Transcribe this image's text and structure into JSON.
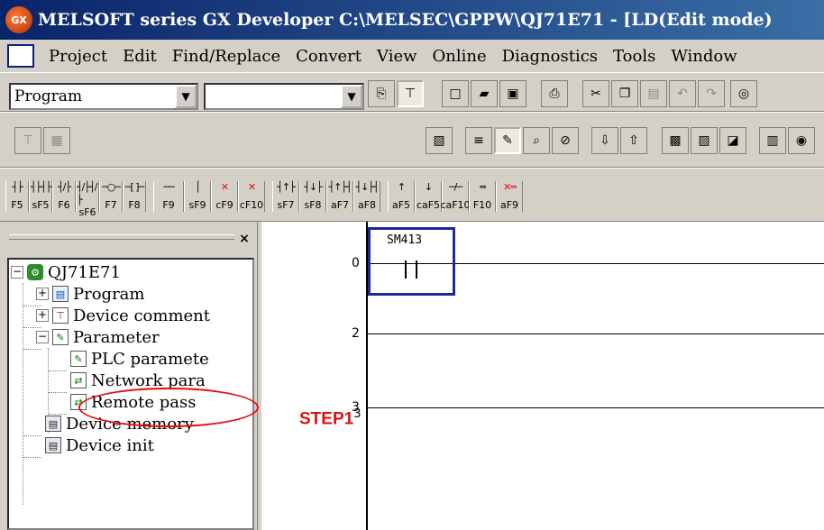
{
  "window": {
    "title": "MELSOFT series GX Developer C:\\MELSEC\\GPPW\\QJ71E71 - [LD(Edit mode)"
  },
  "menubar": [
    "Project",
    "Edit",
    "Find/Replace",
    "Convert",
    "View",
    "Online",
    "Diagnostics",
    "Tools",
    "Window"
  ],
  "toolbar1": {
    "data_type_value": "Program",
    "program_name_value": ""
  },
  "ladder_keys": [
    {
      "sym": "┤├",
      "label": "F5"
    },
    {
      "sym": "┤├┤├",
      "label": "sF5"
    },
    {
      "sym": "┤/├",
      "label": "F6"
    },
    {
      "sym": "┤/├┤/├",
      "label": "sF6"
    },
    {
      "sym": "─○─",
      "label": "F7"
    },
    {
      "sym": "─[ ]─",
      "label": "F8"
    },
    {
      "sym": "──",
      "label": "F9"
    },
    {
      "sym": "│",
      "label": "sF9"
    },
    {
      "sym": "✕",
      "label": "cF9"
    },
    {
      "sym": "✕",
      "label": "cF10"
    },
    {
      "sym": "┤↑├",
      "label": "sF7"
    },
    {
      "sym": "┤↓├",
      "label": "sF8"
    },
    {
      "sym": "┤↑├┤",
      "label": "aF7"
    },
    {
      "sym": "┤↓├┤",
      "label": "aF8"
    },
    {
      "sym": "↑",
      "label": "aF5"
    },
    {
      "sym": "↓",
      "label": "caF5"
    },
    {
      "sym": "─/─",
      "label": "caF10"
    },
    {
      "sym": "═",
      "label": "F10"
    },
    {
      "sym": "✕═",
      "label": "aF9"
    }
  ],
  "tree": {
    "close_glyph": "×",
    "root": "QJ71E71",
    "items": {
      "program": "Program",
      "device_comment": "Device comment",
      "parameter": "Parameter",
      "plc_param": "PLC paramete",
      "network_param": "Network para",
      "remote_pass": "Remote pass",
      "device_memory": "Device memory",
      "device_init": "Device init"
    }
  },
  "ladder": {
    "steps": [
      "0",
      "2",
      "3"
    ],
    "contact_label": "SM413",
    "annotation": "STEP1"
  },
  "colors": {
    "annotation_red": "#e01010",
    "cursor_blue": "#1a2a9a",
    "title_blue": "#0a246a"
  }
}
